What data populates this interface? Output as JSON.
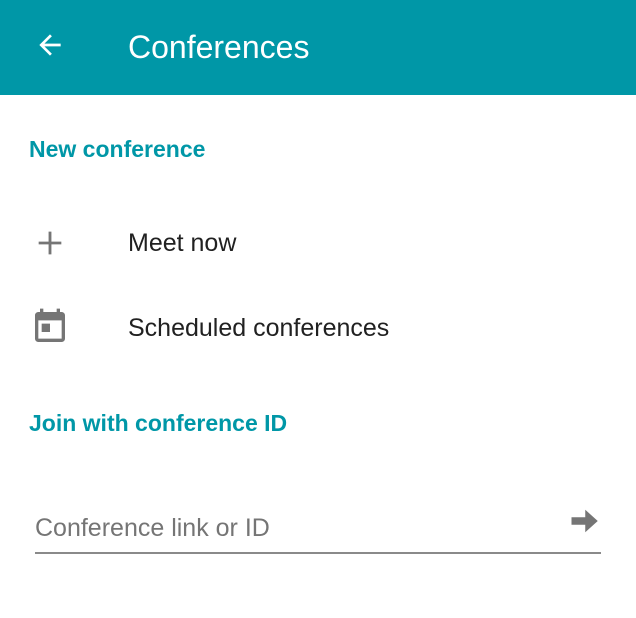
{
  "appbar": {
    "title": "Conferences",
    "back_icon": "arrow-back-icon",
    "background": "#0097a7"
  },
  "sections": {
    "new_conference": {
      "header": "New conference",
      "items": [
        {
          "label": "Meet now",
          "icon": "plus-icon"
        },
        {
          "label": "Scheduled conferences",
          "icon": "calendar-icon"
        }
      ]
    },
    "join": {
      "header": "Join with conference ID",
      "input": {
        "value": "",
        "placeholder": "Conference link or ID",
        "submit_icon": "arrow-forward-icon"
      }
    }
  },
  "colors": {
    "accent": "#0097a7",
    "icon": "#757575",
    "text": "#212121"
  }
}
